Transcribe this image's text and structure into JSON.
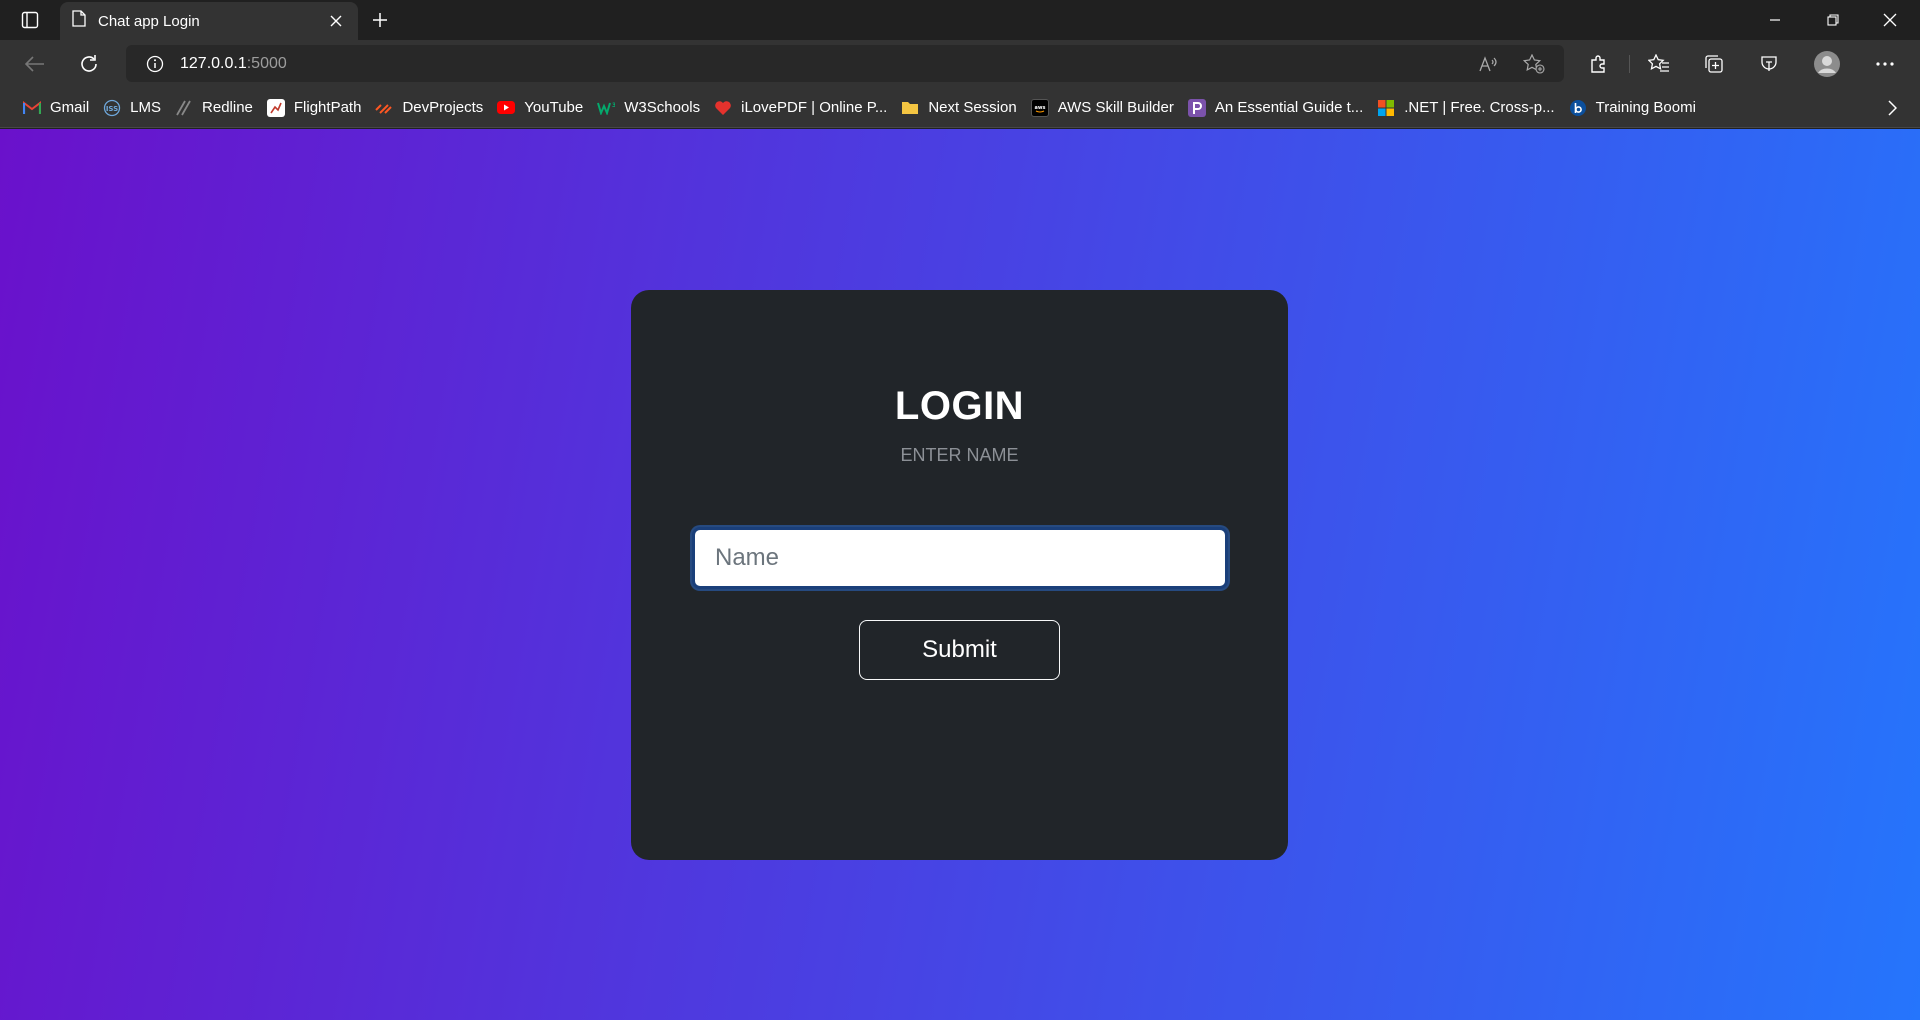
{
  "browser": {
    "tab": {
      "title": "Chat app Login",
      "icon": "page-icon"
    },
    "address": {
      "host": "127.0.0.1",
      "port": ":5000"
    },
    "bookmarks": [
      {
        "label": "Gmail",
        "icon": "gmail-icon",
        "color": "#ea4335"
      },
      {
        "label": "LMS",
        "icon": "lms-icon",
        "color": "#6fa8dc"
      },
      {
        "label": "Redline",
        "icon": "redline-icon",
        "color": "#888888"
      },
      {
        "label": "FlightPath",
        "icon": "flightpath-icon",
        "color": "#ffffff"
      },
      {
        "label": "DevProjects",
        "icon": "devprojects-icon",
        "color": "#ff5722"
      },
      {
        "label": "YouTube",
        "icon": "youtube-icon",
        "color": "#ff0000"
      },
      {
        "label": "W3Schools",
        "icon": "w3schools-icon",
        "color": "#04aa6d"
      },
      {
        "label": "iLovePDF | Online P...",
        "icon": "ilovepdf-icon",
        "color": "#e5322d"
      },
      {
        "label": "Next Session",
        "icon": "folder-icon",
        "color": "#f4c542"
      },
      {
        "label": "AWS Skill Builder",
        "icon": "aws-icon",
        "color": "#000000"
      },
      {
        "label": "An Essential Guide t...",
        "icon": "p-icon",
        "color": "#7b52ab"
      },
      {
        "label": ".NET | Free. Cross-p...",
        "icon": "microsoft-icon",
        "color": "#f25022"
      },
      {
        "label": "Training Boomi",
        "icon": "boomi-icon",
        "color": "#0b4f9c"
      }
    ]
  },
  "login": {
    "title": "LOGIN",
    "subtitle": "ENTER NAME",
    "name_placeholder": "Name",
    "submit_label": "Submit"
  },
  "colors": {
    "gradient_start": "#6a11cb",
    "gradient_end": "#2575fc",
    "card": "#212529"
  }
}
